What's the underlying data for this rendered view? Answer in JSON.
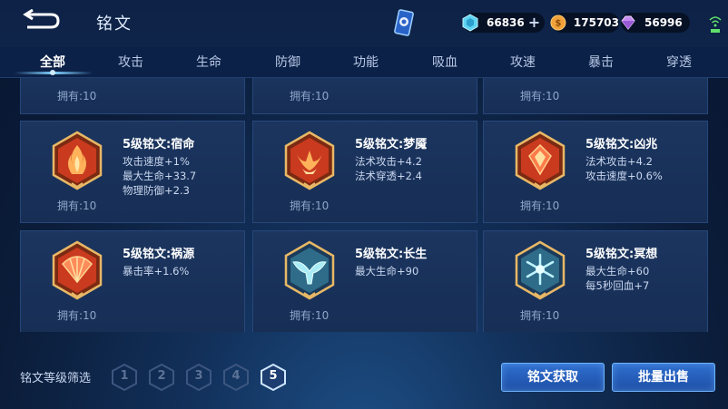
{
  "header": {
    "title": "铭文",
    "currencies": {
      "gem": "66836",
      "gold": "175703",
      "diamond": "56996"
    }
  },
  "tabs": [
    {
      "label": "全部"
    },
    {
      "label": "攻击"
    },
    {
      "label": "生命"
    },
    {
      "label": "防御"
    },
    {
      "label": "功能"
    },
    {
      "label": "吸血"
    },
    {
      "label": "攻速"
    },
    {
      "label": "暴击"
    },
    {
      "label": "穿透"
    }
  ],
  "partial_row": {
    "owned": [
      "拥有:10",
      "拥有:10",
      "拥有:10"
    ]
  },
  "runes": [
    {
      "name": "5级铭文:宿命",
      "stats": [
        "攻击速度+1%",
        "最大生命+33.7",
        "物理防御+2.3"
      ],
      "owned": "拥有:10",
      "color": "#c93a1f",
      "icon": "flame-rune-icon"
    },
    {
      "name": "5级铭文:梦魇",
      "stats": [
        "法术攻击+4.2",
        "法术穿透+2.4"
      ],
      "owned": "拥有:10",
      "color": "#c93a1f",
      "icon": "horned-rune-icon"
    },
    {
      "name": "5级铭文:凶兆",
      "stats": [
        "法术攻击+4.2",
        "攻击速度+0.6%"
      ],
      "owned": "拥有:10",
      "color": "#c93a1f",
      "icon": "gem-rune-icon"
    },
    {
      "name": "5级铭文:祸源",
      "stats": [
        "暴击率+1.6%"
      ],
      "owned": "拥有:10",
      "color": "#c93a1f",
      "icon": "fan-rune-icon"
    },
    {
      "name": "5级铭文:长生",
      "stats": [
        "最大生命+90"
      ],
      "owned": "拥有:10",
      "color": "#4fa9c4",
      "icon": "whale-tail-rune-icon"
    },
    {
      "name": "5级铭文:冥想",
      "stats": [
        "最大生命+60",
        "每5秒回血+7"
      ],
      "owned": "拥有:10",
      "color": "#4fa9c4",
      "icon": "snowflake-rune-icon"
    }
  ],
  "footer": {
    "filter_label": "铭文等级筛选",
    "levels": [
      "1",
      "2",
      "3",
      "4",
      "5"
    ],
    "active_level": "5",
    "acquire_button": "铭文获取",
    "bulk_sell_button": "批量出售"
  }
}
